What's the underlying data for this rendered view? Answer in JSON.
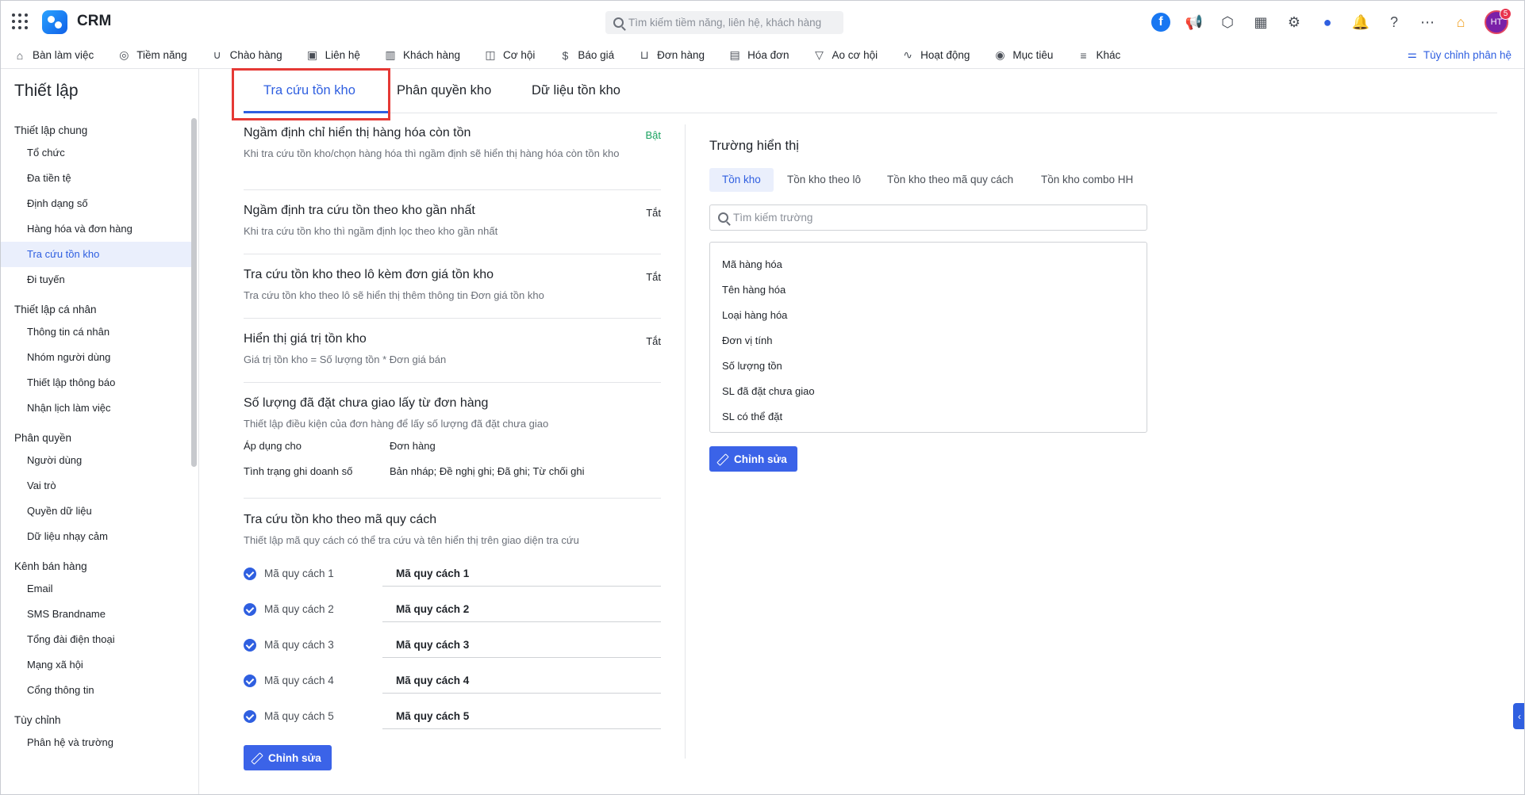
{
  "header": {
    "brand": "CRM",
    "search_placeholder": "Tìm kiếm tiềm năng, liên hệ, khách hàng",
    "avatar_initials": "HT",
    "notification_count": "5",
    "icons": [
      "facebook-icon",
      "megaphone-icon",
      "box-icon",
      "calendar-icon",
      "gear-icon",
      "chat-icon",
      "bell-icon",
      "help-icon",
      "more-icon",
      "location-icon"
    ]
  },
  "nav": {
    "items": [
      {
        "label": "Bàn làm việc",
        "icon": "home-icon"
      },
      {
        "label": "Tiềm năng",
        "icon": "user-circle-icon"
      },
      {
        "label": "Chào hàng",
        "icon": "magnet-icon"
      },
      {
        "label": "Liên hệ",
        "icon": "contact-icon"
      },
      {
        "label": "Khách hàng",
        "icon": "building-icon"
      },
      {
        "label": "Cơ hội",
        "icon": "briefcase-icon"
      },
      {
        "label": "Báo giá",
        "icon": "dollar-doc-icon"
      },
      {
        "label": "Đơn hàng",
        "icon": "cart-icon"
      },
      {
        "label": "Hóa đơn",
        "icon": "invoice-icon"
      },
      {
        "label": "Ao cơ hội",
        "icon": "funnel-icon"
      },
      {
        "label": "Hoạt động",
        "icon": "activity-icon"
      },
      {
        "label": "Mục tiêu",
        "icon": "target-icon"
      },
      {
        "label": "Khác",
        "icon": "menu-icon"
      }
    ],
    "customize_label": "Tùy chỉnh phân hệ"
  },
  "sidebar": {
    "title": "Thiết lập",
    "groups": [
      {
        "label": "Thiết lập chung",
        "items": [
          "Tổ chức",
          "Đa tiền tệ",
          "Định dạng số",
          "Hàng hóa và đơn hàng",
          "Tra cứu tồn kho",
          "Đi tuyến"
        ]
      },
      {
        "label": "Thiết lập cá nhân",
        "items": [
          "Thông tin cá nhân",
          "Nhóm người dùng",
          "Thiết lập thông báo",
          "Nhận lịch làm việc"
        ]
      },
      {
        "label": "Phân quyền",
        "items": [
          "Người dùng",
          "Vai trò",
          "Quyền dữ liệu",
          "Dữ liệu nhạy cảm"
        ]
      },
      {
        "label": "Kênh bán hàng",
        "items": [
          "Email",
          "SMS Brandname",
          "Tổng đài điện thoại",
          "Mạng xã hội",
          "Cổng thông tin"
        ]
      },
      {
        "label": "Tùy chỉnh",
        "items": [
          "Phân hệ và trường"
        ]
      }
    ],
    "active_item": "Tra cứu tồn kho"
  },
  "tabs": [
    "Tra cứu tồn kho",
    "Phân quyền kho",
    "Dữ liệu tồn kho"
  ],
  "settings": [
    {
      "title": "Ngầm định chỉ hiển thị hàng hóa còn tồn",
      "desc": "Khi tra cứu tồn kho/chọn hàng hóa thì ngầm định sẽ hiển thị hàng hóa còn tồn kho",
      "state": "Bật"
    },
    {
      "title": "Ngầm định tra cứu tồn theo kho gần nhất",
      "desc": "Khi tra cứu tồn kho thì ngầm định lọc theo kho gần nhất",
      "state": "Tắt"
    },
    {
      "title": "Tra cứu tồn kho theo lô kèm đơn giá tồn kho",
      "desc": "Tra cứu tồn kho theo lô sẽ hiển thị thêm thông tin Đơn giá tồn kho",
      "state": "Tắt"
    },
    {
      "title": "Hiển thị giá trị tồn kho",
      "desc": "Giá trị tồn kho = Số lượng tồn * Đơn giá bán",
      "state": "Tắt"
    }
  ],
  "ordered_qty": {
    "title": "Số lượng đã đặt chưa giao lấy từ đơn hàng",
    "desc": "Thiết lập điều kiện của đơn hàng để lấy số lượng đã đặt chưa giao",
    "rows": [
      {
        "key": "Áp dụng cho",
        "value": "Đơn hàng"
      },
      {
        "key": "Tình trạng ghi doanh số",
        "value": "Bản nháp; Đề nghị ghi; Đã ghi; Từ chối ghi"
      }
    ]
  },
  "spec": {
    "title": "Tra cứu tồn kho theo mã quy cách",
    "desc": "Thiết lập mã quy cách có thể tra cứu và tên hiển thị trên giao diện tra cứu",
    "rows": [
      {
        "label": "Mã quy cách 1",
        "value": "Mã quy cách 1"
      },
      {
        "label": "Mã quy cách 2",
        "value": "Mã quy cách 2"
      },
      {
        "label": "Mã quy cách 3",
        "value": "Mã quy cách 3"
      },
      {
        "label": "Mã quy cách 4",
        "value": "Mã quy cách 4"
      },
      {
        "label": "Mã quy cách 5",
        "value": "Mã quy cách 5"
      }
    ],
    "edit_label": "Chỉnh sửa"
  },
  "display_fields": {
    "title": "Trường hiển thị",
    "subtabs": [
      "Tồn kho",
      "Tồn kho theo lô",
      "Tồn kho theo mã quy cách",
      "Tồn kho combo HH"
    ],
    "search_placeholder": "Tìm kiếm trường",
    "fields": [
      "Mã hàng hóa",
      "Tên hàng hóa",
      "Loại hàng hóa",
      "Đơn vị tính",
      "Số lượng tồn",
      "SL đã đặt chưa giao",
      "SL có thể đặt"
    ],
    "edit_label": "Chỉnh sửa"
  },
  "colors": {
    "accent": "#2f5fe0",
    "on": "#1aa260",
    "highlight": "#e53935"
  }
}
